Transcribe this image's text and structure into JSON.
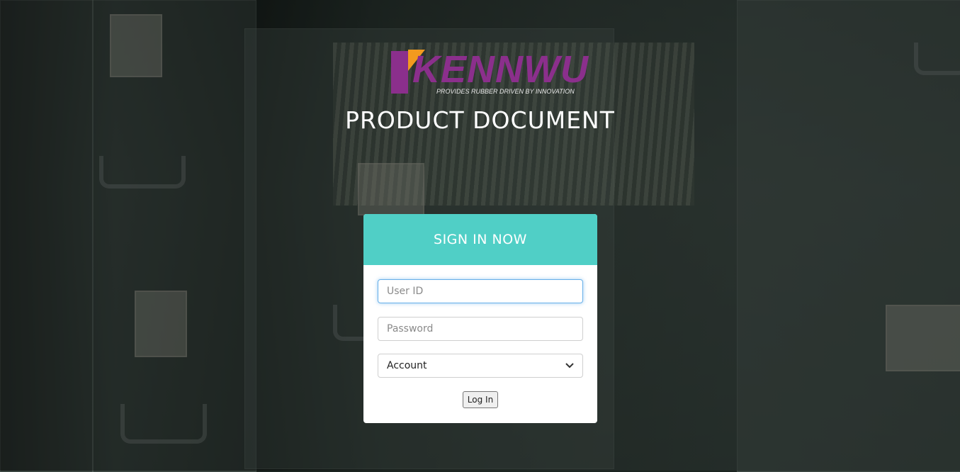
{
  "brand": {
    "name": "KENNWU",
    "tagline": "PROVIDES RUBBER DRIVEN BY INNOVATION",
    "primary_color": "#8b2f8c",
    "accent_color": "#f39a1e"
  },
  "page": {
    "title": "PRODUCT DOCUMENT"
  },
  "login": {
    "header": "SIGN IN NOW",
    "header_color": "#50cfc6",
    "user_id": {
      "value": "",
      "placeholder": "User ID"
    },
    "password": {
      "value": "",
      "placeholder": "Password"
    },
    "account_select": {
      "selected": "Account"
    },
    "submit_label": "Log In"
  },
  "icons": {
    "select_arrow": "chevron-down-icon"
  }
}
